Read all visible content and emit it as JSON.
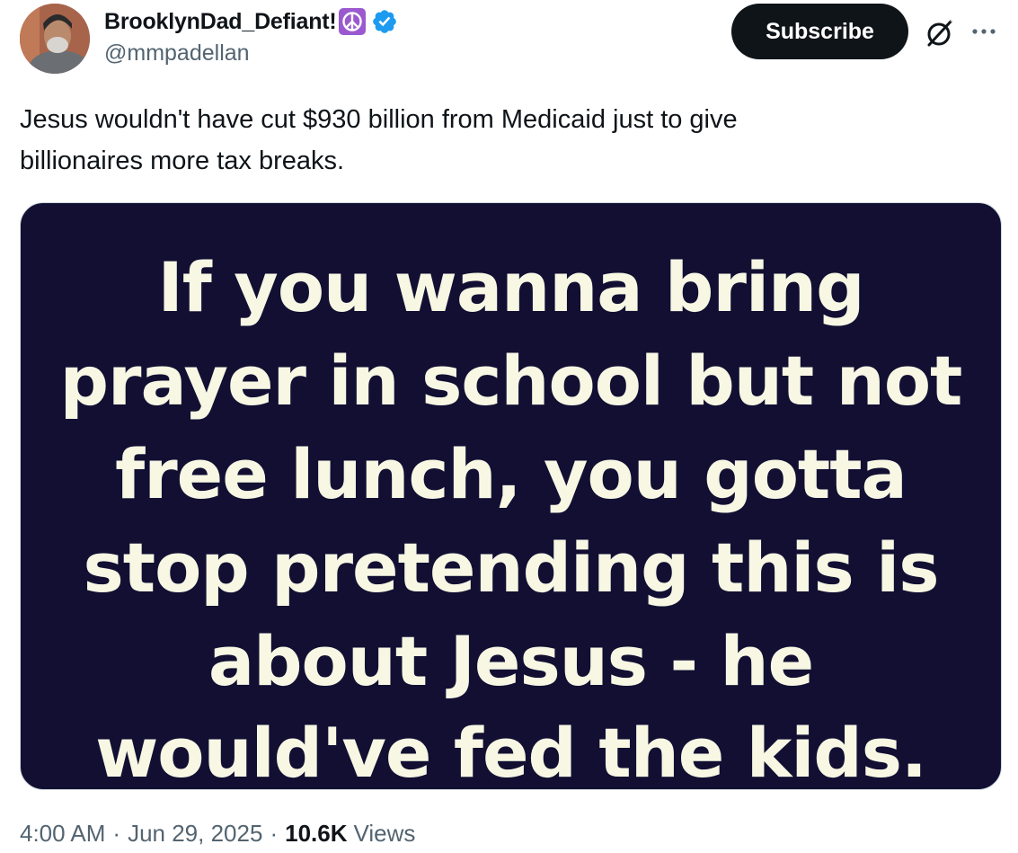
{
  "author": {
    "display_name": "BrooklynDad_Defiant!",
    "handle": "@mmpadellan",
    "badges": [
      "peace-symbol-emoji",
      "verified-badge"
    ],
    "verified_color": "#1d9bf0"
  },
  "actions": {
    "subscribe_label": "Subscribe",
    "grok_icon": "grok-icon",
    "more_icon": "more-horizontal-icon"
  },
  "tweet": {
    "text": "Jesus wouldn't have cut $930 billion from Medicaid just to give\nbillionaires more tax breaks."
  },
  "media": {
    "background_color": "#120f33",
    "text_color": "#f7f7e4",
    "lines": [
      "If you wanna bring",
      "prayer in school but not",
      "free lunch, you gotta",
      "stop pretending this is",
      "about Jesus - he",
      "would've fed the kids."
    ]
  },
  "meta": {
    "time": "4:00 AM",
    "separator": "·",
    "date": "Jun 29, 2025",
    "views_count": "10.6K",
    "views_label": "Views"
  }
}
